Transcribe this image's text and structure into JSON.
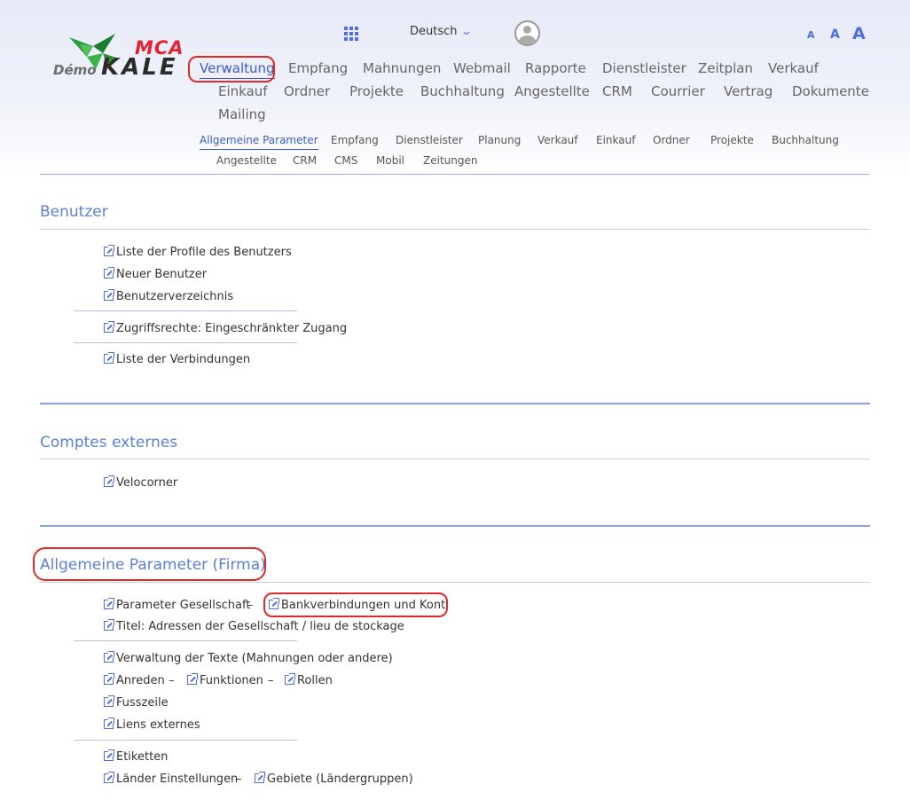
{
  "logo": {
    "brand_top": "MCA",
    "brand_main": "KALE",
    "demo": "Démo"
  },
  "topbar": {
    "language": "Deutsch",
    "font_small": "A",
    "font_medium": "A",
    "font_large": "A"
  },
  "mainnav": {
    "items": [
      "Verwaltung",
      "Empfang",
      "Mahnungen",
      "Webmail",
      "Rapporte",
      "Dienstleister",
      "Zeitplan",
      "Verkauf",
      "Einkauf",
      "Ordner",
      "Projekte",
      "Buchhaltung",
      "Angestellte",
      "CRM",
      "Courrier",
      "Vertrag",
      "Dokumente",
      "Mailing"
    ]
  },
  "subnav": {
    "items": [
      "Allgemeine Parameter",
      "Empfang",
      "Dienstleister",
      "Planung",
      "Verkauf",
      "Einkauf",
      "Ordner",
      "Projekte",
      "Buchhaltung",
      "Angestellte",
      "CRM",
      "CMS",
      "Mobil",
      "Zeitungen"
    ]
  },
  "sections": {
    "benutzer": {
      "title": "Benutzer",
      "links": [
        "Liste der Profile des Benutzers",
        "Neuer Benutzer",
        "Benutzerverzeichnis",
        "Zugriffsrechte: Eingeschränkter Zugang",
        "Liste der Verbindungen"
      ]
    },
    "comptes": {
      "title": "Comptes externes",
      "links": [
        "Velocorner"
      ]
    },
    "allgemein": {
      "title": "Allgemeine Parameter (Firma)",
      "links": [
        "Parameter Gesellschaft",
        "Bankverbindungen und Konti",
        "Titel: Adressen der Gesellschaft / lieu de stockage",
        "Verwaltung der Texte (Mahnungen oder andere)",
        "Anreden",
        "Funktionen",
        "Rollen",
        "Fusszeile",
        "Liens externes",
        "Etiketten",
        "Länder Einstellungen",
        "Gebiete (Ländergruppen)"
      ],
      "separator": "–"
    }
  }
}
